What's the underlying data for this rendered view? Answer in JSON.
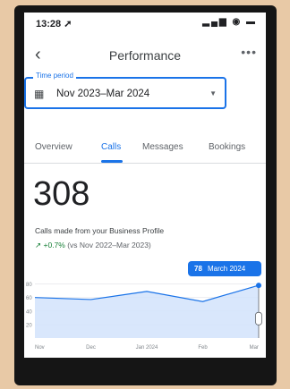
{
  "status_bar": {
    "time": "13:28 ➚",
    "icons": "▂▄▆ ◉ ▬"
  },
  "header": {
    "title": "Performance",
    "back_icon": "arrow-left-icon",
    "more_icon": "more-horizontal-icon"
  },
  "time_period": {
    "label": "Time period",
    "value": "Nov 2023–Mar 2024",
    "icon": "calendar-icon"
  },
  "tabs": [
    {
      "label": "Overview",
      "active": false
    },
    {
      "label": "Calls",
      "active": true
    },
    {
      "label": "Messages",
      "active": false
    },
    {
      "label": "Bookings",
      "active": false
    }
  ],
  "summary": {
    "value": "308",
    "description": "Calls made from your Business Profile",
    "change": "+0.7%",
    "comparison": "(vs Nov 2022–Mar 2023)"
  },
  "tooltip": {
    "value": "78",
    "date": "March 2024"
  },
  "colors": {
    "accent": "#1a73e8",
    "positive": "#188038",
    "fill": "#d2e3fc"
  },
  "chart_data": {
    "type": "area",
    "x": [
      "Nov",
      "Dec",
      "Jan 2024",
      "Feb",
      "Mar"
    ],
    "values": [
      60,
      57,
      69,
      54,
      78
    ],
    "y_ticks": [
      80,
      60,
      40,
      20
    ],
    "ylim": [
      0,
      90
    ],
    "grid": true,
    "highlight": {
      "index": 4,
      "value": 78,
      "label": "March 2024"
    }
  }
}
